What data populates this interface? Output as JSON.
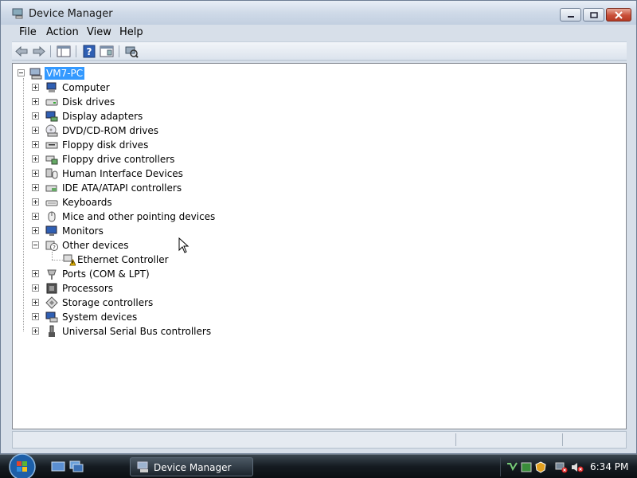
{
  "window": {
    "title": "Device Manager"
  },
  "menu": [
    "File",
    "Action",
    "View",
    "Help"
  ],
  "toolbar": {
    "buttons": [
      "back-icon",
      "forward-icon",
      "properties-view-icon",
      "help-icon",
      "show-hide-console-tree-icon",
      "scan-hardware-icon"
    ]
  },
  "tree": {
    "root": "VM7-PC",
    "items": [
      {
        "label": "Computer"
      },
      {
        "label": "Disk drives"
      },
      {
        "label": "Display adapters"
      },
      {
        "label": "DVD/CD-ROM drives"
      },
      {
        "label": "Floppy disk drives"
      },
      {
        "label": "Floppy drive controllers"
      },
      {
        "label": "Human Interface Devices"
      },
      {
        "label": "IDE ATA/ATAPI controllers"
      },
      {
        "label": "Keyboards"
      },
      {
        "label": "Mice and other pointing devices"
      },
      {
        "label": "Monitors"
      },
      {
        "label": "Other devices",
        "expanded": true,
        "children": [
          "Ethernet Controller"
        ]
      },
      {
        "label": "Ports (COM & LPT)"
      },
      {
        "label": "Processors"
      },
      {
        "label": "Storage controllers"
      },
      {
        "label": "System devices"
      },
      {
        "label": "Universal Serial Bus controllers"
      }
    ]
  },
  "taskbar": {
    "task_label": "Device Manager",
    "clock": "6:34 PM"
  },
  "colors": {
    "selection": "#3399ff",
    "window_frame": "#d7dfe9",
    "taskbar": "#151b21"
  }
}
